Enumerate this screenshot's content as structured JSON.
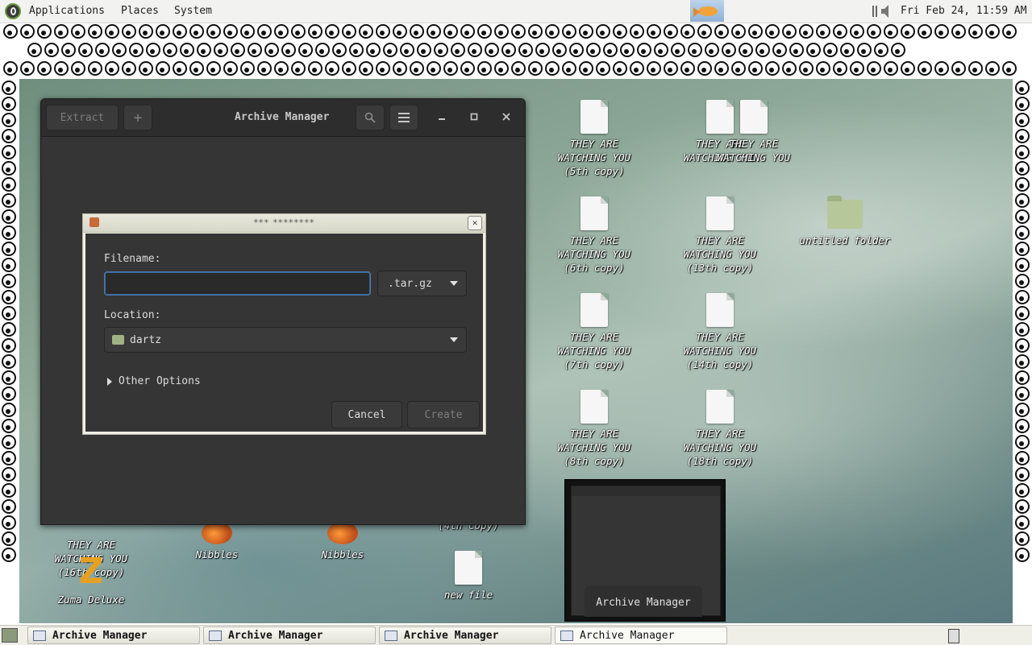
{
  "top_panel": {
    "menus": [
      "Applications",
      "Places",
      "System"
    ],
    "clock": "Fri Feb 24, 11:59 AM"
  },
  "desktop_icons": [
    {
      "label_lines": [
        "THEY ARE",
        "WATCHING YOU",
        "(5th copy)"
      ],
      "type": "document"
    },
    {
      "label_lines": [
        "THEY ARE",
        "WATCHING YOU",
        "(6th copy)"
      ],
      "type": "document"
    },
    {
      "label_lines": [
        "THEY ARE",
        "WATCHING YOU",
        "(7th copy)"
      ],
      "type": "document"
    },
    {
      "label_lines": [
        "THEY ARE",
        "WATCHING YOU",
        "(8th copy)"
      ],
      "type": "document"
    },
    {
      "label_lines": [
        "THEY ARE",
        "WATCHING YOU",
        "(13th copy)"
      ],
      "type": "document"
    },
    {
      "label_lines": [
        "THEY ARE",
        "WATCHING YOU",
        "(14th copy)"
      ],
      "type": "document"
    },
    {
      "label_lines": [
        "THEY ARE",
        "WATCHING YOU",
        "(18th copy)"
      ],
      "type": "document"
    },
    {
      "label_lines": [
        "untitled folder"
      ],
      "type": "folder"
    },
    {
      "label_lines": [
        "THEY ARE",
        "WATCHING YOU",
        "(16th copy)"
      ],
      "type": "document"
    },
    {
      "label_lines": [
        "Nibbles"
      ],
      "type": "game"
    },
    {
      "label_lines": [
        "Nibbles"
      ],
      "type": "game"
    },
    {
      "label_lines": [
        "Zuma Deluxe"
      ],
      "type": "zuma"
    },
    {
      "label_lines": [
        "new file"
      ],
      "type": "document"
    },
    {
      "label_lines": [
        "(4th copy)"
      ],
      "type": "partial"
    }
  ],
  "archive_window": {
    "title": "Archive Manager",
    "extract_label": "Extract",
    "add_label": "+"
  },
  "new_archive_dialog": {
    "title": "*** ********",
    "filename_label": "Filename:",
    "filename_value": "",
    "extension": ".tar.gz",
    "location_label": "Location:",
    "location_value": "dartz",
    "other_options_label": "Other Options",
    "cancel_label": "Cancel",
    "create_label": "Create"
  },
  "window_preview": {
    "label": "Archive Manager"
  },
  "taskbar": {
    "tasks": [
      "Archive Manager",
      "Archive Manager",
      "Archive Manager",
      "Archive Manager"
    ]
  },
  "colors": {
    "dialog_bg": "#353535",
    "focus_border": "#4a78b0",
    "panel_bg": "#f2f2f0"
  }
}
